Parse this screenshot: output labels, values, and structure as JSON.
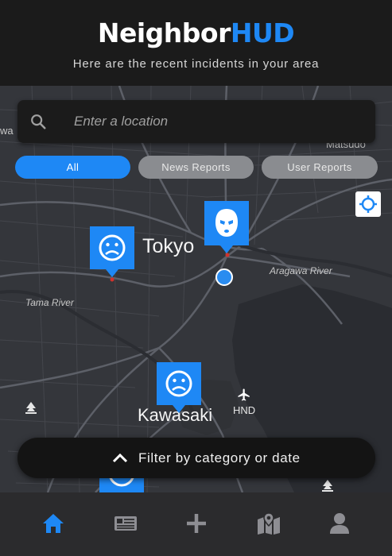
{
  "app": {
    "logo_part1": "Neighbor",
    "logo_part2": "HUD",
    "subtitle": "Here are the recent incidents in your area"
  },
  "search": {
    "placeholder": "Enter a location",
    "icon": "search-icon"
  },
  "filters": {
    "all": "All",
    "news": "News Reports",
    "user": "User Reports",
    "selected": "All"
  },
  "map": {
    "labels": {
      "tokyo": "Tokyo",
      "kawasaki": "Kawasaki",
      "aragawa": "Aragawa River",
      "tama": "Tama River",
      "hnd": "HND",
      "matsudo": "Matsudo",
      "wa": "wa"
    },
    "markers": [
      {
        "name": "sad-face-incident-tokyo",
        "icon": "sad-face-icon"
      },
      {
        "name": "robber-incident-central",
        "icon": "masked-robber-icon"
      },
      {
        "name": "sad-face-incident-kawasaki",
        "icon": "sad-face-icon"
      }
    ]
  },
  "filter_bar": {
    "label": "Filter by category or date",
    "icon": "chevron-up-icon"
  },
  "nav": {
    "items": [
      {
        "name": "home",
        "icon": "home-icon",
        "active": true
      },
      {
        "name": "news",
        "icon": "newspaper-icon",
        "active": false
      },
      {
        "name": "add",
        "icon": "plus-icon",
        "active": false
      },
      {
        "name": "map",
        "icon": "map-marker-icon",
        "active": false
      },
      {
        "name": "profile",
        "icon": "user-icon",
        "active": false
      }
    ]
  },
  "colors": {
    "accent": "#1e88f5",
    "background": "#1b1b1b",
    "map": "#34363b",
    "chip_inactive": "#8a8c90",
    "nav_inactive": "#8e8e93"
  }
}
